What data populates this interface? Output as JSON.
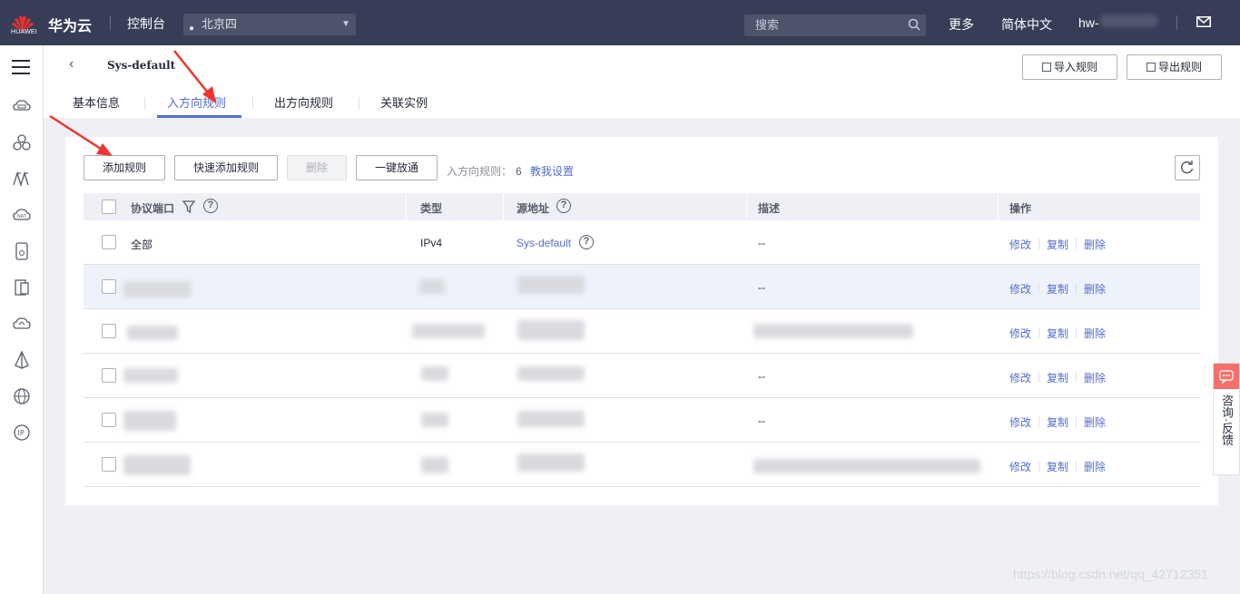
{
  "topbar": {
    "logo_text": "HUAWEI",
    "brand": "华为云",
    "console": "控制台",
    "region": "北京四",
    "search_placeholder": "搜索",
    "more": "更多",
    "language": "简体中文",
    "user": "hw-"
  },
  "page": {
    "title": "Sys-default",
    "import_label": "导入规则",
    "export_label": "导出规则",
    "tabs": [
      "基本信息",
      "入方向规则",
      "出方向规则",
      "关联实例"
    ],
    "active_tab": "入方向规则"
  },
  "toolbar": {
    "add_rule": "添加规则",
    "quick_add": "快速添加规则",
    "delete": "删除",
    "allow_all": "一键放通",
    "rule_count_label": "入方向规则：",
    "rule_count": "6",
    "help_link": "教我设置"
  },
  "table": {
    "headers": [
      "协议端口",
      "类型",
      "源地址",
      "描述",
      "操作"
    ],
    "rows": [
      {
        "protocol": "全部",
        "type": "IPv4",
        "source": "Sys-default",
        "description": "--"
      },
      {
        "protocol": "",
        "type": "",
        "source": "",
        "description": "--"
      },
      {
        "protocol": "",
        "type": "",
        "source": "",
        "description": ""
      },
      {
        "protocol": "",
        "type": "",
        "source": "",
        "description": "--"
      },
      {
        "protocol": "",
        "type": "",
        "source": "",
        "description": "--"
      },
      {
        "protocol": "",
        "type": "",
        "source": "",
        "description": ""
      }
    ],
    "actions": {
      "modify": "修改",
      "copy": "复制",
      "delete": "删除"
    }
  },
  "feedback": {
    "label": "咨询·反馈"
  },
  "watermark": "https://blog.csdn.net/qq_42712351",
  "colors": {
    "topbar": "#383d57",
    "accent": "#526ecc",
    "feedback": "#f66f6a",
    "arrow": "#f0342c"
  }
}
